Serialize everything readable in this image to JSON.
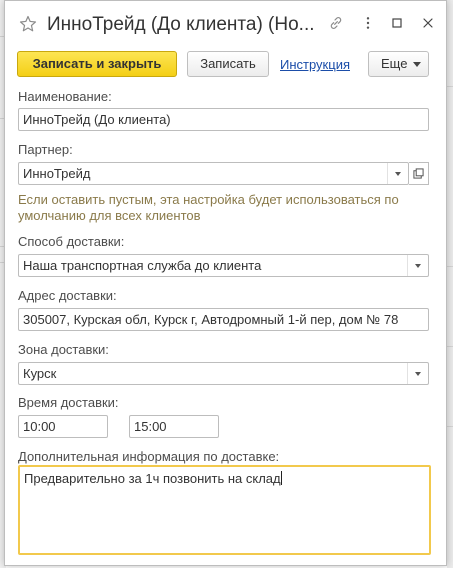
{
  "window": {
    "title": "ИнноТрейд (До клиента) (Но..."
  },
  "toolbar": {
    "save_close_label": "Записать и закрыть",
    "save_label": "Записать",
    "instruction_label": "Инструкция",
    "more_label": "Еще"
  },
  "form": {
    "name": {
      "label": "Наименование:",
      "value": "ИнноТрейд (До клиента)"
    },
    "partner": {
      "label": "Партнер:",
      "value": "ИнноТрейд",
      "hint_line1": "Если оставить пустым, эта настройка будет использоваться по",
      "hint_line2": "умолчанию для всех клиентов"
    },
    "delivery_method": {
      "label": "Способ доставки:",
      "value": "Наша транспортная служба до клиента"
    },
    "delivery_address": {
      "label": "Адрес доставки:",
      "value": "305007, Курская обл, Курск г, Автодромный 1-й пер, дом № 78"
    },
    "delivery_zone": {
      "label": "Зона доставки:",
      "value": "Курск"
    },
    "delivery_time": {
      "label": "Время доставки:",
      "from": "10:00",
      "to": "15:00"
    },
    "extra_info": {
      "label": "Дополнительная информация по доставке:",
      "value": "Предварительно за 1ч позвонить на склад"
    }
  },
  "colors": {
    "primary_button": "#f4cf16",
    "focus_border": "#f2c94c",
    "link": "#1b4da8",
    "hint_text": "#8a7a4a"
  },
  "icons": [
    "star-icon",
    "link-icon",
    "more-vertical-icon",
    "maximize-icon",
    "close-icon",
    "chevron-down-icon",
    "open-form-icon"
  ]
}
